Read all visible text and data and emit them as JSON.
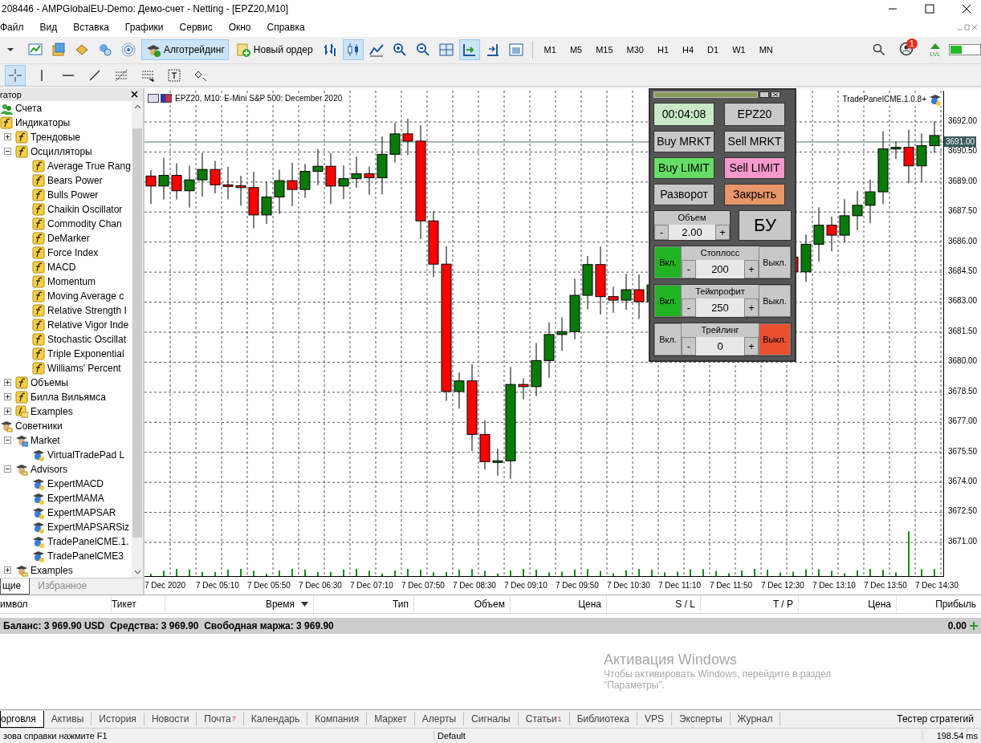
{
  "window": {
    "title": "208446 - AMPGlobalEU-Demo: Демо-счет - Netting - [EPZ20,M10]"
  },
  "menu": [
    "Файл",
    "Вид",
    "Вставка",
    "Графики",
    "Сервис",
    "Окно",
    "Справка"
  ],
  "toolbar": {
    "items": [
      {
        "kind": "dropdown",
        "selected": false
      },
      {
        "kind": "new-chart",
        "selected": false
      },
      {
        "kind": "profiles",
        "selected": false
      },
      {
        "kind": "market-watch",
        "selected": false
      },
      {
        "kind": "data-window",
        "selected": false
      },
      {
        "kind": "signal",
        "selected": false
      },
      {
        "kind": "algo",
        "label": "Алготрейдинг",
        "selected": true
      },
      {
        "kind": "order",
        "label": "Новый ордер",
        "selected": false
      },
      {
        "kind": "bars",
        "selected": false
      },
      {
        "kind": "candles",
        "selected": true
      },
      {
        "kind": "line",
        "selected": false
      },
      {
        "kind": "zoom-in",
        "selected": false
      },
      {
        "kind": "zoom-out",
        "selected": false
      },
      {
        "kind": "tile",
        "selected": false
      },
      {
        "kind": "autoscroll",
        "selected": true
      },
      {
        "kind": "shift",
        "selected": false
      },
      {
        "kind": "templates",
        "selected": false
      }
    ],
    "timeframes": [
      "M1",
      "M5",
      "M15",
      "M30",
      "H1",
      "H4",
      "D1",
      "W1",
      "MN"
    ],
    "notification_count": "1",
    "lvl_label": "LVL"
  },
  "drawing_toolbar": [
    {
      "kind": "crosshair",
      "selected": true
    },
    {
      "kind": "vline",
      "selected": false
    },
    {
      "kind": "hline",
      "selected": false
    },
    {
      "kind": "trendline",
      "selected": false
    },
    {
      "kind": "fibo",
      "selected": false
    },
    {
      "kind": "fibo-fan",
      "selected": false
    },
    {
      "kind": "text",
      "selected": false
    },
    {
      "kind": "shapes",
      "selected": false
    }
  ],
  "navigator": {
    "title": "гатор",
    "tree": [
      {
        "kind": "accounts",
        "label": "Счета"
      },
      {
        "kind": "indicator",
        "label": "Индикаторы",
        "children": [
          {
            "kind": "indicator",
            "label": "Трендовые",
            "expanded": false
          },
          {
            "kind": "indicator",
            "label": "Осцилляторы",
            "expanded": true,
            "children": [
              {
                "kind": "indicator",
                "label": "Average True Rang"
              },
              {
                "kind": "indicator",
                "label": "Bears Power"
              },
              {
                "kind": "indicator",
                "label": "Bulls Power"
              },
              {
                "kind": "indicator",
                "label": "Chaikin Oscillator"
              },
              {
                "kind": "indicator",
                "label": "Commodity Chan"
              },
              {
                "kind": "indicator",
                "label": "DeMarker"
              },
              {
                "kind": "indicator",
                "label": "Force Index"
              },
              {
                "kind": "indicator",
                "label": "MACD"
              },
              {
                "kind": "indicator",
                "label": "Momentum"
              },
              {
                "kind": "indicator",
                "label": "Moving Average c"
              },
              {
                "kind": "indicator",
                "label": "Relative Strength I"
              },
              {
                "kind": "indicator",
                "label": "Relative Vigor Inde"
              },
              {
                "kind": "indicator",
                "label": "Stochastic Oscillat"
              },
              {
                "kind": "indicator",
                "label": "Triple Exponential"
              },
              {
                "kind": "indicator",
                "label": "Williams' Percent"
              }
            ]
          },
          {
            "kind": "indicator",
            "label": "Объемы",
            "expanded": false
          },
          {
            "kind": "indicator",
            "label": "Билла Вильямса",
            "expanded": false
          },
          {
            "kind": "indicator-folder",
            "label": "Examples",
            "expanded": false
          }
        ]
      },
      {
        "kind": "experts",
        "label": "Советники",
        "children": [
          {
            "kind": "market",
            "label": "Market",
            "expanded": true,
            "children": [
              {
                "kind": "advisor",
                "label": "VirtualTradePad  L"
              }
            ]
          },
          {
            "kind": "experts",
            "label": "Advisors",
            "expanded": true,
            "children": [
              {
                "kind": "advisor",
                "label": "ExpertMACD"
              },
              {
                "kind": "advisor",
                "label": "ExpertMAMA"
              },
              {
                "kind": "advisor",
                "label": "ExpertMAPSAR"
              },
              {
                "kind": "advisor",
                "label": "ExpertMAPSARSiz"
              },
              {
                "kind": "advisor",
                "label": "TradePanelCME.1."
              },
              {
                "kind": "advisor",
                "label": "TradePanelCME3"
              }
            ]
          },
          {
            "kind": "experts",
            "label": "Examples",
            "expanded": false
          }
        ]
      }
    ],
    "tabs": [
      {
        "label": "щие",
        "selected": true
      },
      {
        "label": "Избранное",
        "selected": false
      }
    ]
  },
  "chart": {
    "title": "EPZ20, M10:  E-Mini S&P 500: December 2020",
    "expert": "TradePanelCME.1.0.8+",
    "price_labels": [
      "3692.00",
      "3690.50",
      "3689.00",
      "3687.50",
      "3686.00",
      "3684.50",
      "3683.00",
      "3681.50",
      "3680.00",
      "3678.50",
      "3677.00",
      "3675.50",
      "3674.00",
      "3672.50",
      "3671.00"
    ],
    "current_price": "3691.00",
    "time_labels": [
      "7 Dec 2020",
      "7 Dec 05:10",
      "7 Dec 05:50",
      "7 Dec 06:30",
      "7 Dec 07:10",
      "7 Dec 07:50",
      "7 Dec 08:30",
      "7 Dec 09:10",
      "7 Dec 09:50",
      "7 Dec 10:30",
      "7 Dec 11:10",
      "7 Dec 11:50",
      "7 Dec 12:30",
      "7 Dec 13:10",
      "7 Dec 13:50",
      "7 Dec 14:30"
    ]
  },
  "trade_panel": {
    "timer": "00:04:08",
    "symbol": "EPZ20",
    "buttons": [
      {
        "label": "Buy MRKT",
        "color": "#c8c8c8"
      },
      {
        "label": "Sell MRKT",
        "color": "#c8c8c8"
      },
      {
        "label": "Buy LIMIT",
        "color": "#66dd66"
      },
      {
        "label": "Sell LIMIT",
        "color": "#f799cc"
      },
      {
        "label": "Разворот",
        "color": "#c8c8c8"
      },
      {
        "label": "Закрыть",
        "color": "#e8956a"
      }
    ],
    "volume": {
      "title": "Объем",
      "minus": "-",
      "value": "2.00",
      "plus": "+"
    },
    "breakeven": "БУ",
    "protections": [
      {
        "title": "Стоплосс",
        "on_label": "Вкл.",
        "off_label": "Выкл.",
        "minus": "-",
        "value": "200",
        "plus": "+",
        "enabled": true
      },
      {
        "title": "Тейкпрофит",
        "on_label": "Вкл.",
        "off_label": "Выкл.",
        "minus": "-",
        "value": "250",
        "plus": "+",
        "enabled": true
      },
      {
        "title": "Трейлинг",
        "on_label": "Вкл.",
        "off_label": "Выкл.",
        "minus": "-",
        "value": "0",
        "plus": "+",
        "enabled": false
      }
    ]
  },
  "table": {
    "columns": [
      {
        "label": "имвол",
        "sorted": false
      },
      {
        "label": "Тикет",
        "sorted": false
      },
      {
        "label": "Время",
        "sorted": true
      },
      {
        "label": "Тип",
        "sorted": false
      },
      {
        "label": "Объем",
        "sorted": false
      },
      {
        "label": "Цена",
        "sorted": false
      },
      {
        "label": "S / L",
        "sorted": false
      },
      {
        "label": "T / P",
        "sorted": false
      },
      {
        "label": "Цена",
        "sorted": false
      },
      {
        "label": "Прибыль",
        "sorted": false
      }
    ],
    "summary": "Баланс: 3 969.90 USD  Средства: 3 969.90  Свободная маржа: 3 969.90",
    "profit": "0.00"
  },
  "activation": {
    "title": "Активация Windows",
    "hint": "Чтобы активировать Windows, перейдите в раздел \"Параметры\"."
  },
  "bottom_tabs": [
    {
      "label": "орговля",
      "selected": true
    },
    {
      "label": "Активы",
      "selected": false
    },
    {
      "label": "История",
      "selected": false
    },
    {
      "label": "Новости",
      "selected": false
    },
    {
      "label": "Почта",
      "selected": false,
      "badge": "7"
    },
    {
      "label": "Календарь",
      "selected": false
    },
    {
      "label": "Компания",
      "selected": false
    },
    {
      "label": "Маркет",
      "selected": false
    },
    {
      "label": "Алерты",
      "selected": false
    },
    {
      "label": "Сигналы",
      "selected": false
    },
    {
      "label": "Статьи",
      "selected": false,
      "badge": "1"
    },
    {
      "label": "Библиотека",
      "selected": false
    },
    {
      "label": "VPS",
      "selected": false
    },
    {
      "label": "Эксперты",
      "selected": false
    },
    {
      "label": "Журнал",
      "selected": false
    }
  ],
  "tester_tab": "Тестер стратегий",
  "status_bar": [
    "зова справки нажмите F1",
    "Default",
    "198.54 ms"
  ]
}
